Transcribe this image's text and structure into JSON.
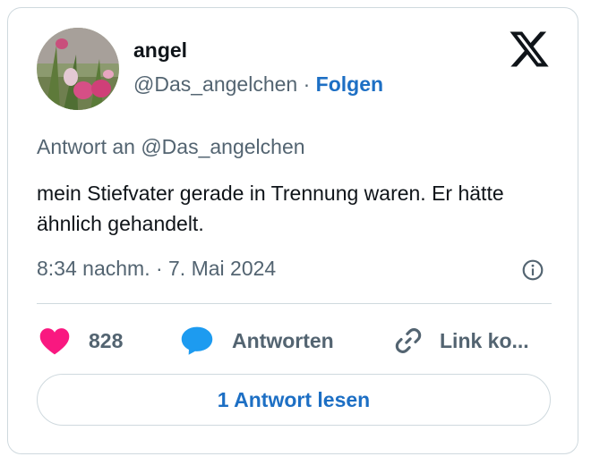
{
  "user": {
    "display_name": "angel",
    "handle": "@Das_angelchen",
    "separator": "·",
    "follow_label": "Folgen"
  },
  "tweet": {
    "reply_to": "Antwort an @Das_angelchen",
    "text": "mein Stiefvater gerade in Trennung waren. Er hätte ähnlich gehandelt.",
    "timestamp": "8:34 nachm. · 7. Mai 2024"
  },
  "actions": {
    "like_count": "828",
    "reply_label": "Antworten",
    "copy_link_label": "Link ko..."
  },
  "read_replies_label": "1 Antwort lesen",
  "icons": {
    "brand": "x-logo-icon",
    "info": "info-icon",
    "like": "heart-icon",
    "reply": "speech-bubble-icon",
    "link": "link-icon"
  },
  "colors": {
    "like": "#f91880",
    "reply": "#1d9bf0",
    "link_accent": "#1d6fc4",
    "muted_text": "#536471",
    "border": "#cfd9de"
  }
}
